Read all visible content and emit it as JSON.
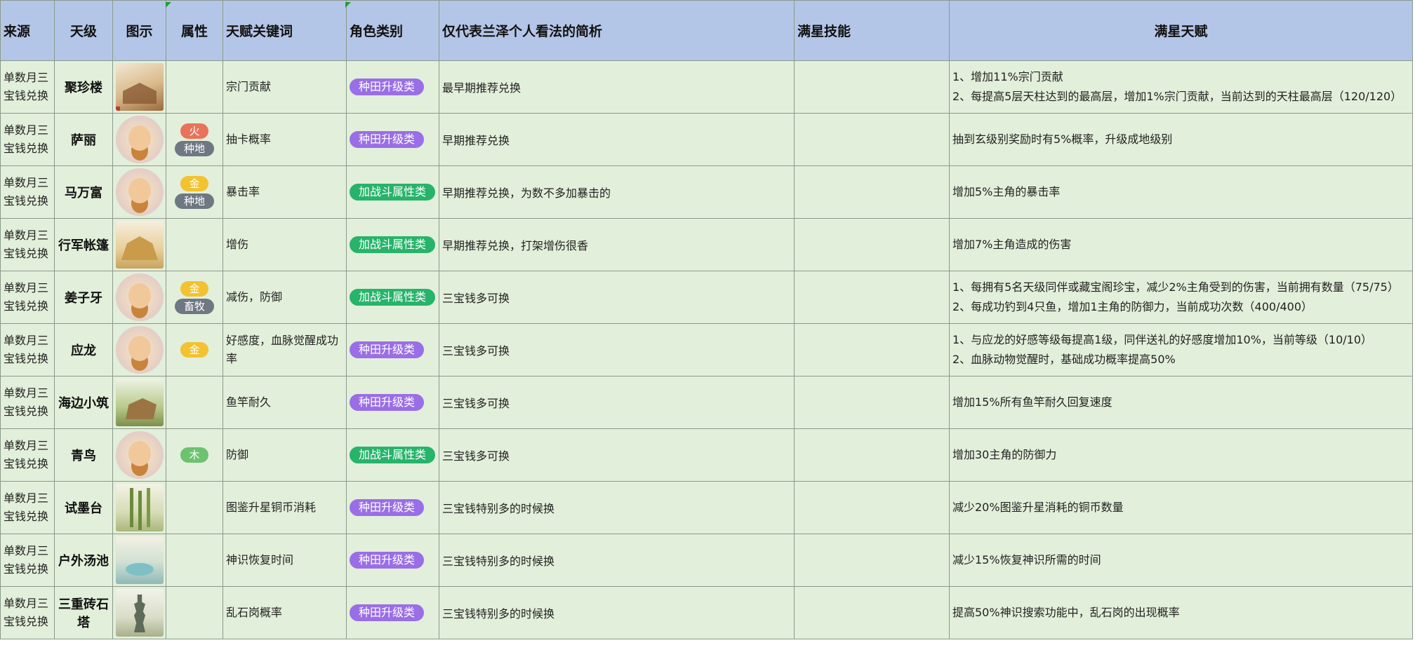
{
  "headers": [
    "来源",
    "天级",
    "图示",
    "属性",
    "天赋关键词",
    "角色类别",
    "仅代表兰泽个人看法的简析",
    "满星技能",
    "满星天赋"
  ],
  "colors": {
    "header_bg": "#b4c6e7",
    "row_bg": "#e2efda",
    "category_purple": "#9a6ee6",
    "category_green": "#27b36a",
    "attr_fire": "#e8735a",
    "attr_gold": "#f2c230",
    "attr_wood": "#6cc26e",
    "attr_gray": "#6f7783"
  },
  "rows": [
    {
      "source": "单数月三宝钱兑换",
      "level": "聚珍楼",
      "image_icon": "building-thumbnail",
      "attrs": [],
      "keyword": "宗门贡献",
      "category": "种田升级类",
      "category_color": "purple",
      "analysis": "最早期推荐兑换",
      "skill": "",
      "talent": [
        "1、增加11%宗门贡献",
        "2、每提高5层天柱达到的最高层，增加1%宗门贡献，当前达到的天柱最高层（120/120）"
      ]
    },
    {
      "source": "单数月三宝钱兑换",
      "level": "萨丽",
      "image_icon": "character-portrait",
      "attrs": [
        {
          "label": "火",
          "color": "#e8735a"
        },
        {
          "label": "种地",
          "color": "#6f7783"
        }
      ],
      "keyword": "抽卡概率",
      "category": "种田升级类",
      "category_color": "purple",
      "analysis": "早期推荐兑换",
      "skill": "",
      "talent": [
        "抽到玄级别奖励时有5%概率，升级成地级别"
      ]
    },
    {
      "source": "单数月三宝钱兑换",
      "level": "马万富",
      "image_icon": "character-portrait",
      "attrs": [
        {
          "label": "金",
          "color": "#f2c230"
        },
        {
          "label": "种地",
          "color": "#6f7783"
        }
      ],
      "keyword": "暴击率",
      "category": "加战斗属性类",
      "category_color": "green",
      "analysis": "早期推荐兑换，为数不多加暴击的",
      "skill": "",
      "talent": [
        "增加5%主角的暴击率"
      ]
    },
    {
      "source": "单数月三宝钱兑换",
      "level": "行军帐篷",
      "image_icon": "tent-thumbnail",
      "attrs": [],
      "keyword": "增伤",
      "category": "加战斗属性类",
      "category_color": "green",
      "analysis": "早期推荐兑换，打架增伤很香",
      "skill": "",
      "talent": [
        "增加7%主角造成的伤害"
      ]
    },
    {
      "source": "单数月三宝钱兑换",
      "level": "姜子牙",
      "image_icon": "character-portrait",
      "attrs": [
        {
          "label": "金",
          "color": "#f2c230"
        },
        {
          "label": "畜牧",
          "color": "#6f7783"
        }
      ],
      "keyword": "减伤，防御",
      "category": "加战斗属性类",
      "category_color": "green",
      "analysis": "三宝钱多可换",
      "skill": "",
      "talent": [
        "1、每拥有5名天级同伴或藏宝阁珍宝，减少2%主角受到的伤害，当前拥有数量（75/75）",
        "2、每成功钓到4只鱼，增加1主角的防御力，当前成功次数（400/400）"
      ]
    },
    {
      "source": "单数月三宝钱兑换",
      "level": "应龙",
      "image_icon": "character-portrait",
      "attrs": [
        {
          "label": "金",
          "color": "#f2c230"
        }
      ],
      "keyword": "好感度，血脉觉醒成功率",
      "category": "种田升级类",
      "category_color": "purple",
      "analysis": "三宝钱多可换",
      "skill": "",
      "talent": [
        "1、与应龙的好感等级每提高1级，同伴送礼的好感度增加10%，当前等级（10/10）",
        "2、血脉动物觉醒时，基础成功概率提高50%"
      ]
    },
    {
      "source": "单数月三宝钱兑换",
      "level": "海边小筑",
      "image_icon": "hut-thumbnail",
      "attrs": [],
      "keyword": "鱼竿耐久",
      "category": "种田升级类",
      "category_color": "purple",
      "analysis": "三宝钱多可换",
      "skill": "",
      "talent": [
        "增加15%所有鱼竿耐久回复速度"
      ]
    },
    {
      "source": "单数月三宝钱兑换",
      "level": "青鸟",
      "image_icon": "character-portrait",
      "attrs": [
        {
          "label": "木",
          "color": "#6cc26e"
        }
      ],
      "keyword": "防御",
      "category": "加战斗属性类",
      "category_color": "green",
      "analysis": "三宝钱多可换",
      "skill": "",
      "talent": [
        "增加30主角的防御力"
      ]
    },
    {
      "source": "单数月三宝钱兑换",
      "level": "试墨台",
      "image_icon": "bamboo-thumbnail",
      "attrs": [],
      "keyword": "图鉴升星铜币消耗",
      "category": "种田升级类",
      "category_color": "purple",
      "analysis": "三宝钱特别多的时候换",
      "skill": "",
      "talent": [
        "减少20%图鉴升星消耗的铜币数量"
      ]
    },
    {
      "source": "单数月三宝钱兑换",
      "level": "户外汤池",
      "image_icon": "pool-thumbnail",
      "attrs": [],
      "keyword": "神识恢复时间",
      "category": "种田升级类",
      "category_color": "purple",
      "analysis": "三宝钱特别多的时候换",
      "skill": "",
      "talent": [
        "减少15%恢复神识所需的时间"
      ]
    },
    {
      "source": "单数月三宝钱兑换",
      "level": "三重砖石塔",
      "image_icon": "tower-thumbnail",
      "attrs": [],
      "keyword": "乱石岗概率",
      "category": "种田升级类",
      "category_color": "purple",
      "analysis": "三宝钱特别多的时候换",
      "skill": "",
      "talent": [
        "提高50%神识搜索功能中，乱石岗的出现概率"
      ]
    }
  ]
}
